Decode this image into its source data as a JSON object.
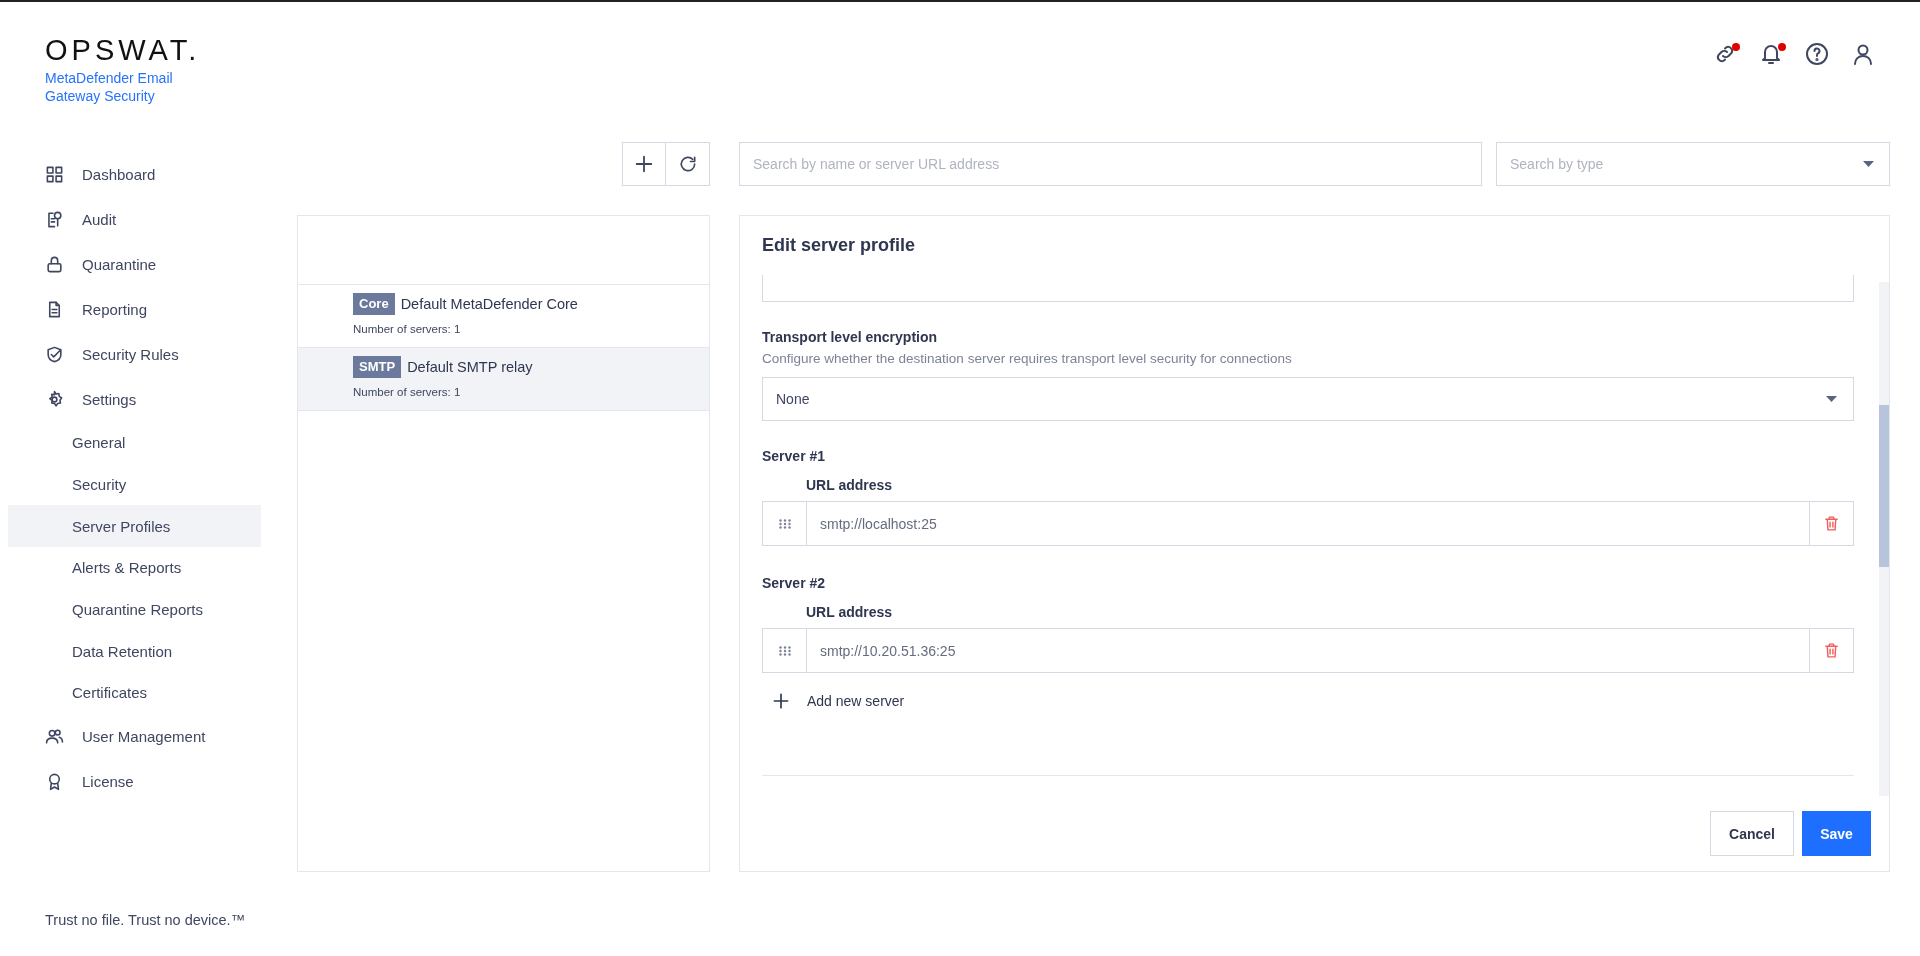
{
  "brand": {
    "logo": "OPSWAT.",
    "product": "MetaDefender Email Gateway Security"
  },
  "header_icons": [
    {
      "notification": true
    },
    {
      "notification": true
    },
    {
      "notification": false
    },
    {
      "notification": false
    }
  ],
  "sidebar": {
    "items": [
      {
        "label": "Dashboard",
        "selected": false
      },
      {
        "label": "Audit",
        "selected": false
      },
      {
        "label": "Quarantine",
        "selected": false
      },
      {
        "label": "Reporting",
        "selected": false
      },
      {
        "label": "Security Rules",
        "selected": false
      },
      {
        "label": "Settings",
        "selected": false,
        "children": [
          {
            "label": "General",
            "selected": false
          },
          {
            "label": "Security",
            "selected": false
          },
          {
            "label": "Server Profiles",
            "selected": true
          },
          {
            "label": "Alerts & Reports",
            "selected": false
          },
          {
            "label": "Quarantine Reports",
            "selected": false
          },
          {
            "label": "Data Retention",
            "selected": false
          },
          {
            "label": "Certificates",
            "selected": false
          }
        ]
      },
      {
        "label": "User Management",
        "selected": false
      },
      {
        "label": "License",
        "selected": false
      }
    ]
  },
  "tagline": "Trust no file. Trust no device.™",
  "search": {
    "placeholder": "Search by name or server URL address"
  },
  "type_filter": {
    "placeholder": "Search by type"
  },
  "profiles": [
    {
      "type": "Core",
      "name": "Default MetaDefender Core",
      "servers": "Number of servers: 1",
      "selected": false
    },
    {
      "type": "SMTP",
      "name": "Default SMTP relay",
      "servers": "Number of servers: 1",
      "selected": true
    }
  ],
  "editor": {
    "title": "Edit server profile",
    "transport": {
      "label": "Transport level encryption",
      "description": "Configure whether the destination server requires transport level security for connections",
      "value": "None"
    },
    "servers": [
      {
        "label": "Server #1",
        "field_label": "URL address",
        "value": "smtp://localhost:25"
      },
      {
        "label": "Server #2",
        "field_label": "URL address",
        "value": "smtp://10.20.51.36:25"
      }
    ],
    "add_server": "Add new server",
    "buttons": [
      {
        "label": "Cancel",
        "kind": "secondary"
      },
      {
        "label": "Save",
        "kind": "primary"
      }
    ]
  }
}
